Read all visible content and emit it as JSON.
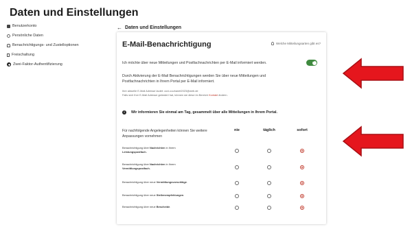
{
  "page_title": "Daten und Einstellungen",
  "sidebar": {
    "items": [
      {
        "label": "Benutzerkonto",
        "icon": "lock-icon"
      },
      {
        "label": "Persönliche Daten",
        "icon": "user-icon"
      },
      {
        "label": "Benachrichtigungs- und Zustelloptionen",
        "icon": "bell-icon"
      },
      {
        "label": "Freischaltung",
        "icon": "file-icon"
      },
      {
        "label": "Zwei-Faktor-Authentifizierung",
        "icon": "plus-circle-icon"
      }
    ]
  },
  "breadcrumb": {
    "back_icon": "←",
    "label": "Daten und Einstellungen"
  },
  "card": {
    "title": "E-Mail-Benachrichtigung",
    "help_link": "Welche Mitteilungsarten gibt es?",
    "opt_in_text": "Ich möchte über neue Mitteilungen und Postfachnachrichten per E-Mail informiert werden.",
    "toggle_on": true,
    "description": "Durch Aktivierung der E-Mail Benachrichtigungen werden Sie über neue Mitteilungen und Postfachnachrichten in Ihrem Portal per E-Mail informiert.",
    "email_note": "Ihre aktuelle E-Mail Adresse lautet: cuvi-cuuhanet2023@web.de",
    "change_note_pre": "Falls sich Ihre E-Mail Adresse geändert hat, können sie diese im Bereich ",
    "change_note_link": "Kontakt",
    "change_note_post": " ändern.",
    "info_icon": "i",
    "info_text": "Wir informieren Sie einmal am Tag, gesammelt über alle Mitteilungen in Ihrem Portal.",
    "table_intro": "Für nachfolgende Angelegenheiten können Sie weitere Anpassungen vornehmen",
    "columns": [
      "nie",
      "täglich",
      "sofort"
    ],
    "rows": [
      {
        "pre": "Benachrichtigung über ",
        "bold": "Nachrichten",
        "post": " in Ihrem",
        "line2": "Leistungspostfach.",
        "selected": "sofort"
      },
      {
        "pre": "Benachrichtigung über ",
        "bold": "Nachrichten",
        "post": " in Ihrem",
        "line2": "Vermittlungspostfach.",
        "selected": "sofort"
      },
      {
        "pre": "Benachrichtigung über neue ",
        "bold": "Vermittlungsvorschläge",
        "post": ".",
        "line2": "",
        "selected": "sofort"
      },
      {
        "pre": "Benachrichtigung über neue ",
        "bold": "Stellenempfehlungen",
        "post": ".",
        "line2": "",
        "selected": "sofort"
      },
      {
        "pre": "Benachrichtigung über neue ",
        "bold": "Bescheide",
        "post": ".",
        "line2": "",
        "selected": "sofort"
      }
    ]
  },
  "colors": {
    "toggle_on": "#3f8a3f",
    "radio_selected": "#c0392b",
    "annotation_arrow": "#e5161d"
  }
}
